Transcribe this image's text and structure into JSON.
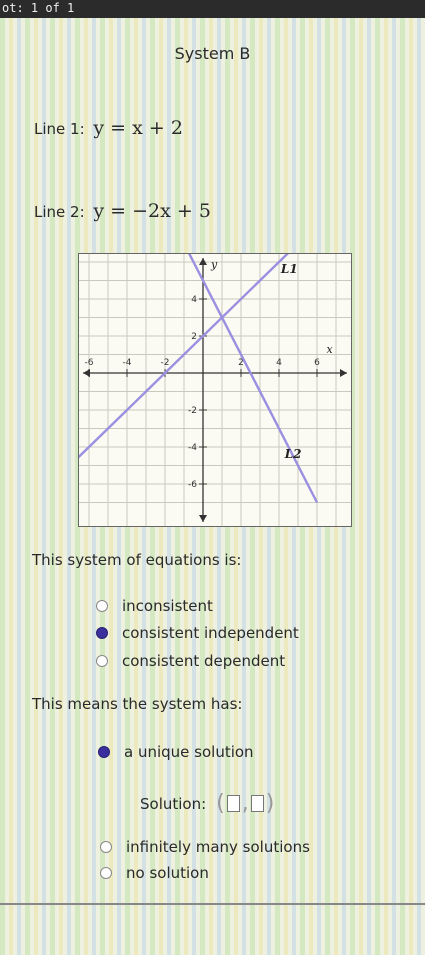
{
  "header": {
    "page_indicator": "ot: 1 of 1"
  },
  "system_title": "System B",
  "line1": {
    "label": "Line 1:",
    "equation": "y = x + 2"
  },
  "line2": {
    "label": "Line 2:",
    "equation": "y = −2x + 5"
  },
  "graph": {
    "x_axis_label": "x",
    "y_axis_label": "y",
    "x_tick_labels": [
      "-6",
      "-4",
      "-2",
      "2",
      "4",
      "6"
    ],
    "y_tick_labels": [
      "4",
      "2",
      "-2",
      "-4",
      "-6"
    ],
    "line1_label": "L1",
    "line2_label": "L2",
    "line_color": "#9a8fe0",
    "grid": true
  },
  "chart_data": {
    "type": "line",
    "xlim": [
      -7,
      7
    ],
    "ylim": [
      -7,
      7
    ],
    "series": [
      {
        "name": "L1",
        "equation": "y = x + 2",
        "points": [
          [
            -7,
            -5
          ],
          [
            6,
            8
          ]
        ]
      },
      {
        "name": "L2",
        "equation": "y = -2x + 5",
        "points": [
          [
            -1,
            7
          ],
          [
            6,
            -7
          ]
        ]
      }
    ]
  },
  "question1": {
    "prompt": "This system of equations is:",
    "options": [
      {
        "label": "inconsistent",
        "selected": false
      },
      {
        "label": "consistent independent",
        "selected": true
      },
      {
        "label": "consistent dependent",
        "selected": false
      }
    ]
  },
  "question2": {
    "prompt": "This means the system has:",
    "unique": {
      "label": "a unique solution",
      "selected": true
    },
    "solution_label": "Solution:",
    "infinite": {
      "label": "infinitely many solutions",
      "selected": false
    },
    "none": {
      "label": "no solution",
      "selected": false
    }
  }
}
